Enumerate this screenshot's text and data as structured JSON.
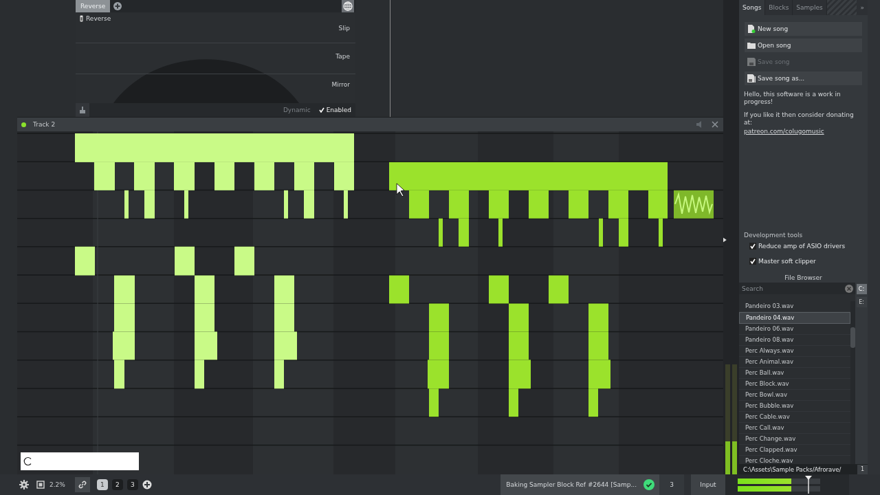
{
  "effect_panel": {
    "tabs": [
      {
        "label": "Reverse",
        "selected": true
      }
    ],
    "param_label": "Reverse",
    "modes": [
      "Slip",
      "Tape",
      "Mirror"
    ],
    "dynamic_label": "Dynamic",
    "enabled": {
      "label": "Enabled",
      "checked": true
    }
  },
  "track": {
    "name": "Track 2",
    "active": true
  },
  "sidebar": {
    "tabs": [
      {
        "label": "Songs",
        "selected": true
      },
      {
        "label": "Blocks",
        "selected": false
      },
      {
        "label": "Samples",
        "selected": false
      }
    ],
    "collapse": "»",
    "actions": [
      {
        "label": "New song",
        "kind": "new",
        "disabled": false
      },
      {
        "label": "Open song",
        "kind": "open",
        "disabled": false
      },
      {
        "label": "Save song",
        "kind": "save",
        "disabled": true
      },
      {
        "label": "Save song as...",
        "kind": "saveas",
        "disabled": false
      }
    ],
    "notice": "Hello, this software is a work in progress!",
    "donate_text": "If you like it then consider donating at:",
    "donate_link": "patreon.com/colugomusic",
    "dev_tools": {
      "title": "Development tools",
      "options": [
        {
          "label": "Reduce amp of ASIO drivers",
          "checked": true
        },
        {
          "label": "Master soft clipper",
          "checked": true
        }
      ]
    }
  },
  "file_browser": {
    "title": "File Browser",
    "search": {
      "placeholder": "Search"
    },
    "drives": [
      {
        "label": "C:",
        "selected": true
      },
      {
        "label": "E:",
        "selected": false
      }
    ],
    "files": [
      {
        "name": "Pandeiro 03.wav",
        "selected": false
      },
      {
        "name": "Pandeiro 04.wav",
        "selected": true
      },
      {
        "name": "Pandeiro 06.wav",
        "selected": false
      },
      {
        "name": "Pandeiro 08.wav",
        "selected": false
      },
      {
        "name": "Perc Always.wav",
        "selected": false
      },
      {
        "name": "Perc Animal.wav",
        "selected": false
      },
      {
        "name": "Perc Ball.wav",
        "selected": false
      },
      {
        "name": "Perc Block.wav",
        "selected": false
      },
      {
        "name": "Perc Bowl.wav",
        "selected": false
      },
      {
        "name": "Perc Bubble.wav",
        "selected": false
      },
      {
        "name": "Perc Cable.wav",
        "selected": false
      },
      {
        "name": "Perc Call.wav",
        "selected": false
      },
      {
        "name": "Perc Change.wav",
        "selected": false
      },
      {
        "name": "Perc Clapped.wav",
        "selected": false
      },
      {
        "name": "Perc Cloche.wav",
        "selected": false
      }
    ],
    "path": "C:\\Assets\\Sample Packs/Afrorave/",
    "page": "1"
  },
  "track_meters": [
    {
      "level": 0.3
    },
    {
      "level": 0.3
    }
  ],
  "status_bar": {
    "cpu": "2.2%",
    "pages": [
      {
        "label": "1",
        "selected": true
      },
      {
        "label": "2",
        "selected": false
      },
      {
        "label": "3",
        "selected": false
      }
    ],
    "task": "Baking Sampler Block Ref #2644 [Samp...",
    "count": "3",
    "input": "Input",
    "meters": [
      {
        "level": 0.65
      },
      {
        "level": 0.65
      }
    ]
  }
}
